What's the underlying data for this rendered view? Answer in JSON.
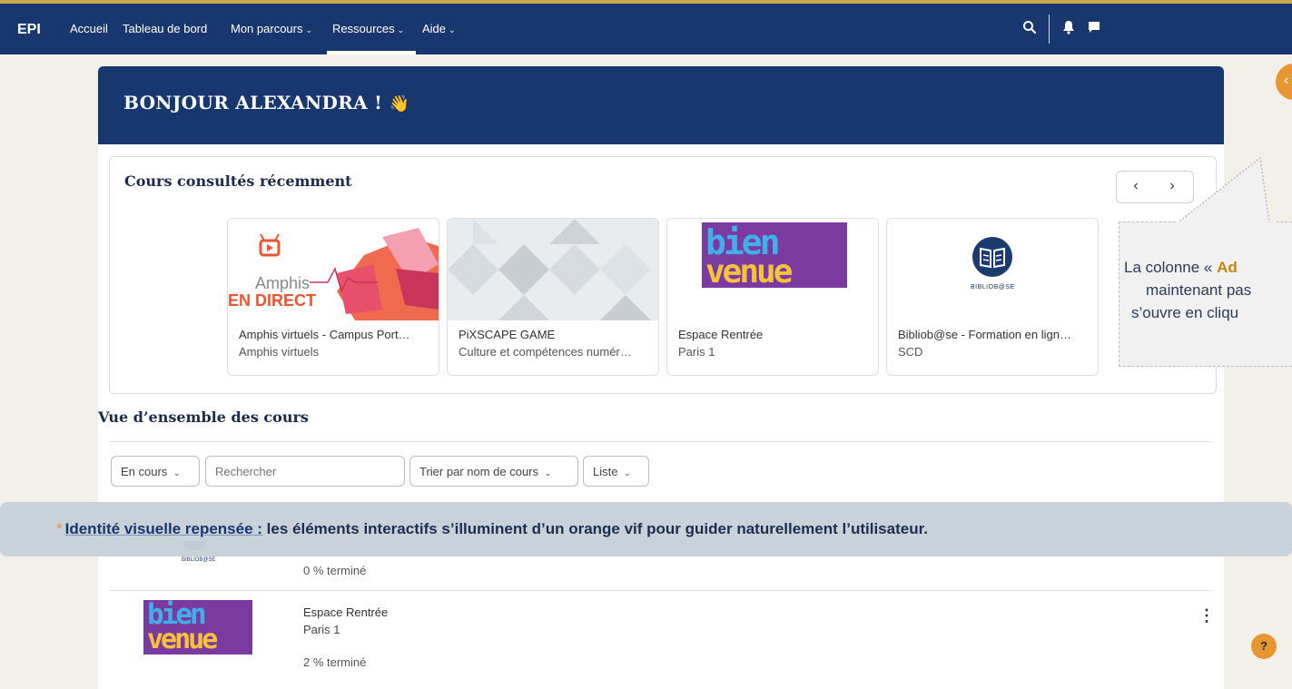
{
  "navbar": {
    "brand": "EPI",
    "items": [
      {
        "label": "Accueil"
      },
      {
        "label": "Tableau de bord"
      },
      {
        "label": "Mon parcours",
        "chevron": "⌄"
      },
      {
        "label": "Ressources",
        "chevron": "⌄"
      },
      {
        "label": "Aide",
        "chevron": "⌄"
      }
    ],
    "active_item": "Ressources",
    "icons": [
      "search-icon",
      "bell-icon",
      "chat-icon"
    ]
  },
  "right_drawer_toggle": {
    "glyph": "‹"
  },
  "greeting": {
    "title": "BONJOUR ALEXANDRA !",
    "emoji": "👋"
  },
  "recent": {
    "title": "Cours consultés récemment",
    "prev": "‹",
    "next": "›",
    "cards": [
      {
        "name": "Amphis virtuels - Campus Port…",
        "category": "Amphis virtuels",
        "image_text_1": "Amphis",
        "image_text_2": "EN DIRECT"
      },
      {
        "name": "PiXSCAPE GAME",
        "category": "Culture et compétences numér…"
      },
      {
        "name": "Espace Rentrée",
        "category": "Paris 1",
        "image_text_1": "bien",
        "image_text_2": "venue"
      },
      {
        "name": "Bibliob@se - Formation en lign…",
        "category": "SCD",
        "image_text_1": "BIBLIOB@SE"
      }
    ]
  },
  "overview": {
    "title": "Vue d’ensemble des cours",
    "filter_label": "En cours",
    "search_placeholder": "Rechercher",
    "sort_label": "Trier par nom de cours",
    "view_label": "Liste",
    "courses": [
      {
        "name": "",
        "category": "",
        "progress": "0 % terminé",
        "logo_text": "BIBLIOB@SE"
      },
      {
        "name": "Espace Rentrée",
        "category": "Paris 1",
        "progress": "2 % terminé",
        "logo_text_1": "bien",
        "logo_text_2": "venue"
      }
    ],
    "kebab": "⋮"
  },
  "banner": {
    "star": "*",
    "emphasis": "Identité visuelle repensée :",
    "text": " les éléments interactifs s’illuminent d’un orange vif pour guider naturellement l’utilisateur."
  },
  "callout": {
    "line1_prefix": "La colonne « ",
    "line1_bold": "Ad",
    "line2": "maintenant pas",
    "line3": "s’ouvre en cliqu"
  },
  "help": {
    "label": "?"
  },
  "colors": {
    "navy": "#18376e",
    "accent_orange": "#e8962f",
    "gold": "#c9a94a"
  }
}
